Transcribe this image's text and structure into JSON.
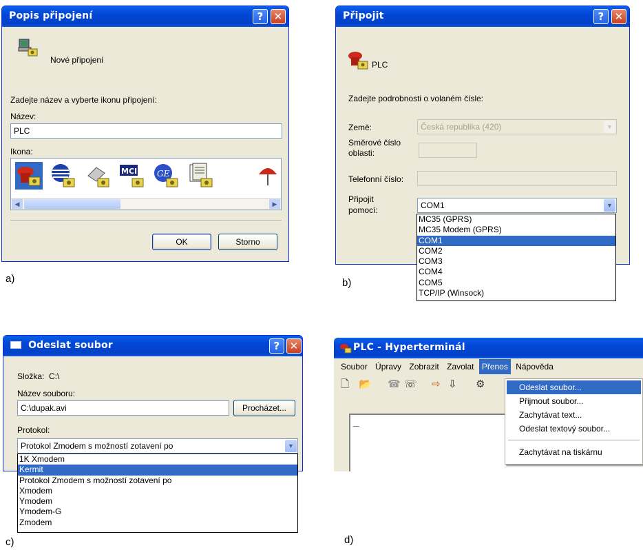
{
  "panel_a": {
    "title": "Popis připojení",
    "header": "Nové připojení",
    "prompt": "Zadejte název a vyberte ikonu připojení:",
    "name_label": "Název:",
    "name_value": "PLC",
    "icon_label": "Ikona:",
    "ok": "OK",
    "cancel": "Storno",
    "caption": "a)"
  },
  "panel_b": {
    "title": "Připojit",
    "header": "PLC",
    "prompt": "Zadejte podrobnosti o volaném čísle:",
    "country_label": "Země:",
    "country_value": "Česká republika (420)",
    "area_label_1": "Směrové číslo",
    "area_label_2": "oblasti:",
    "phone_label": "Telefonní číslo:",
    "connect_label_1": "Připojit",
    "connect_label_2": "pomocí:",
    "connect_value": "COM1",
    "options": [
      "MC35 (GPRS)",
      "MC35 Modem (GPRS)",
      "COM1",
      "COM2",
      "COM3",
      "COM4",
      "COM5",
      "TCP/IP (Winsock)"
    ],
    "selected_index": 2,
    "caption": "b)"
  },
  "panel_c": {
    "title": "Odeslat soubor",
    "folder": "Složka:  C:\\",
    "filename_label": "Název souboru:",
    "filename_value": "C:\\dupak.avi",
    "browse": "Procházet...",
    "protocol_label": "Protokol:",
    "protocol_value": "Protokol Zmodem s možností zotavení po",
    "options": [
      "1K Xmodem",
      "Kermit",
      "Protokol Zmodem s možností zotavení po",
      "Xmodem",
      "Ymodem",
      "Ymodem-G",
      "Zmodem"
    ],
    "selected_index": 1,
    "caption": "c)"
  },
  "panel_d": {
    "title": "PLC - Hyperterminál",
    "menu": [
      "Soubor",
      "Úpravy",
      "Zobrazit",
      "Zavolat",
      "Přenos",
      "Nápověda"
    ],
    "dropdown": [
      "Odeslat soubor...",
      "Přijmout soubor...",
      "Zachytávat text...",
      "Odeslat textový soubor...",
      "Zachytávat na tiskárnu"
    ],
    "cursor": "_",
    "caption": "d)"
  }
}
